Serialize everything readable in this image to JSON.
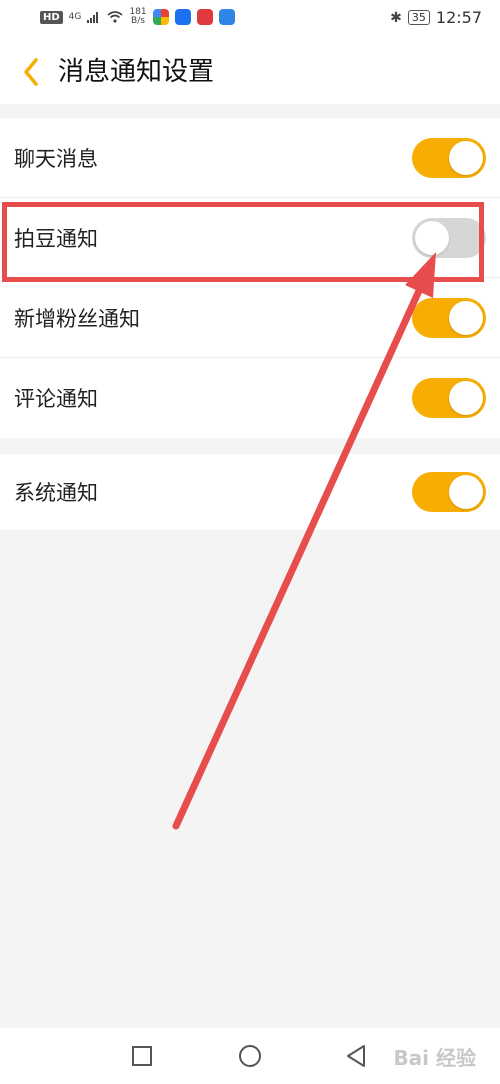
{
  "status_bar": {
    "hd": "HD",
    "network": "4G",
    "speed_top": "181",
    "speed_bottom": "B/s",
    "battery": "35",
    "time": "12:57"
  },
  "header": {
    "title": "消息通知设置",
    "back_icon": "chevron-left-icon"
  },
  "settings": [
    {
      "label": "聊天消息",
      "enabled": true
    },
    {
      "label": "拍豆通知",
      "enabled": false
    },
    {
      "label": "新增粉丝通知",
      "enabled": true
    },
    {
      "label": "评论通知",
      "enabled": true
    },
    {
      "label": "系统通知",
      "enabled": true
    }
  ],
  "navbar": {
    "watermark": "Bai 经验"
  },
  "colors": {
    "accent": "#f7ad04",
    "toggle_off": "#d6d6d6",
    "annotation": "#e84d4d"
  }
}
